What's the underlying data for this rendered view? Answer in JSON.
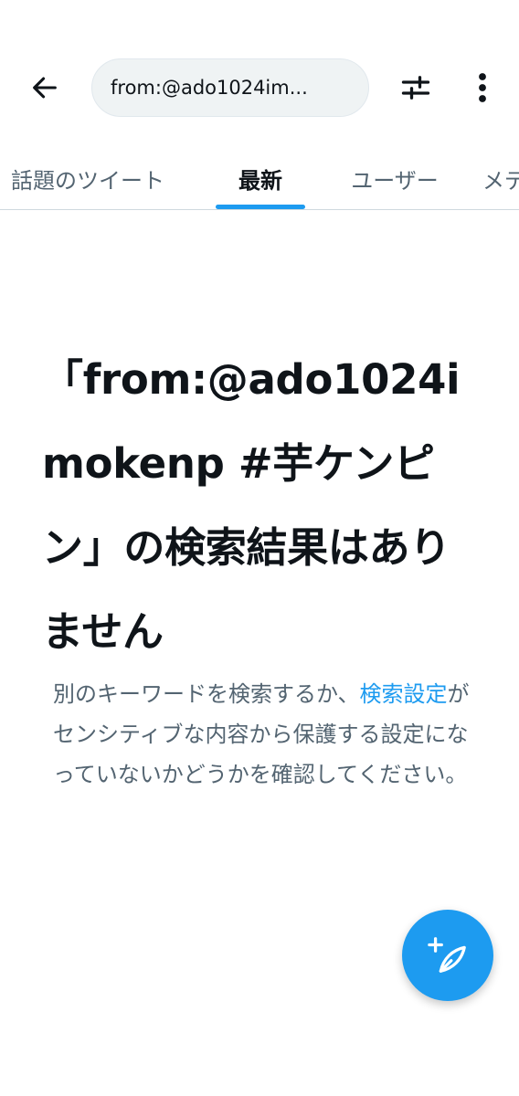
{
  "header": {
    "back_icon": "arrow-left-icon",
    "search_query": "from:@ado1024im...",
    "filter_icon": "sliders-icon",
    "more_icon": "more-vertical-icon"
  },
  "tabs": [
    {
      "label": "話題のツイート",
      "active": false
    },
    {
      "label": "最新",
      "active": true
    },
    {
      "label": "ユーザー",
      "active": false
    },
    {
      "label": "メディア",
      "active": false
    }
  ],
  "empty_state": {
    "title": "「from:@ado1024imokenp #芋ケンピン」の検索結果はありません",
    "desc_before": "別のキーワードを検索するか、",
    "desc_link": "検索設定",
    "desc_after": "がセンシティブな内容から保護する設定になっていないかどうかを確認してください。"
  },
  "fab": {
    "icon": "compose-feather-icon"
  },
  "colors": {
    "accent": "#1d9bf0",
    "text_primary": "#0f1419",
    "text_secondary": "#536471",
    "search_bg": "#eff3f4"
  }
}
